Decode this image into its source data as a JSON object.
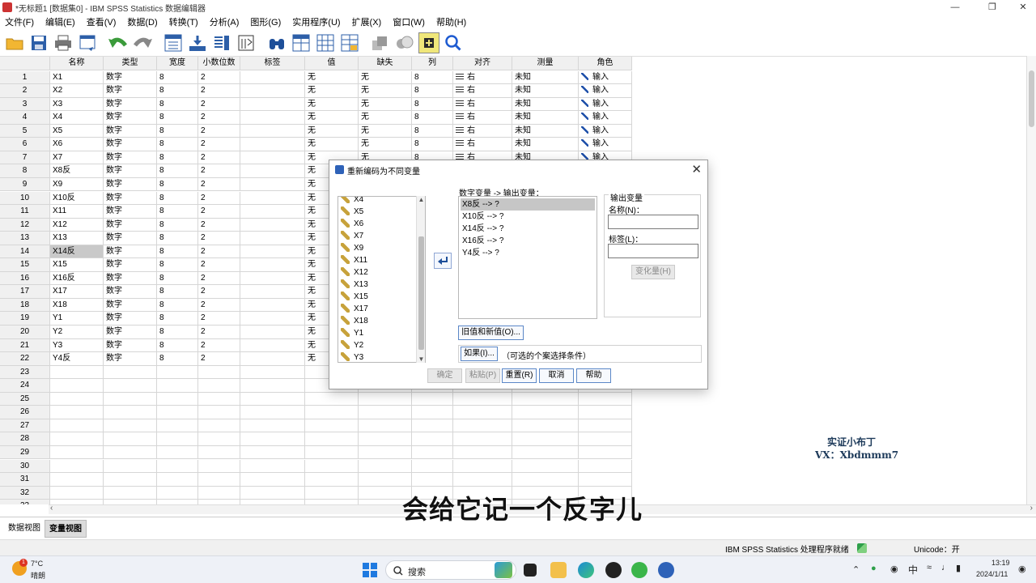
{
  "window": {
    "title": "*无标题1 [数据集0] - IBM SPSS Statistics 数据编辑器"
  },
  "menu": [
    "文件(F)",
    "编辑(E)",
    "查看(V)",
    "数据(D)",
    "转换(T)",
    "分析(A)",
    "图形(G)",
    "实用程序(U)",
    "扩展(X)",
    "窗口(W)",
    "帮助(H)"
  ],
  "toolbar_icons": [
    "open-folder-icon",
    "save-icon",
    "print-icon",
    "dialog-recall-icon",
    "undo-icon",
    "redo-icon",
    "goto-case-icon",
    "goto-variable-icon",
    "variables-icon",
    "find-icon",
    "insert-cases-icon",
    "insert-variable-icon",
    "split-file-icon",
    "weight-cases-icon",
    "select-cases-icon",
    "value-labels-icon",
    "use-sets-icon",
    "search-icon"
  ],
  "grid": {
    "columns": [
      "名称",
      "类型",
      "宽度",
      "小数位数",
      "标签",
      "值",
      "缺失",
      "列",
      "对齐",
      "测量",
      "角色"
    ],
    "rows": [
      [
        "X1",
        "数字",
        "8",
        "2",
        "",
        "无",
        "无",
        "8",
        "右",
        "未知",
        "输入"
      ],
      [
        "X2",
        "数字",
        "8",
        "2",
        "",
        "无",
        "无",
        "8",
        "右",
        "未知",
        "输入"
      ],
      [
        "X3",
        "数字",
        "8",
        "2",
        "",
        "无",
        "无",
        "8",
        "右",
        "未知",
        "输入"
      ],
      [
        "X4",
        "数字",
        "8",
        "2",
        "",
        "无",
        "无",
        "8",
        "右",
        "未知",
        "输入"
      ],
      [
        "X5",
        "数字",
        "8",
        "2",
        "",
        "无",
        "无",
        "8",
        "右",
        "未知",
        "输入"
      ],
      [
        "X6",
        "数字",
        "8",
        "2",
        "",
        "无",
        "无",
        "8",
        "右",
        "未知",
        "输入"
      ],
      [
        "X7",
        "数字",
        "8",
        "2",
        "",
        "无",
        "无",
        "8",
        "右",
        "未知",
        "输入"
      ],
      [
        "X8反",
        "数字",
        "8",
        "2",
        "",
        "无",
        "",
        "",
        "",
        "",
        ""
      ],
      [
        "X9",
        "数字",
        "8",
        "2",
        "",
        "无",
        "",
        "",
        "",
        "",
        ""
      ],
      [
        "X10反",
        "数字",
        "8",
        "2",
        "",
        "无",
        "",
        "",
        "",
        "",
        ""
      ],
      [
        "X11",
        "数字",
        "8",
        "2",
        "",
        "无",
        "",
        "",
        "",
        "",
        ""
      ],
      [
        "X12",
        "数字",
        "8",
        "2",
        "",
        "无",
        "",
        "",
        "",
        "",
        ""
      ],
      [
        "X13",
        "数字",
        "8",
        "2",
        "",
        "无",
        "",
        "",
        "",
        "",
        ""
      ],
      [
        "X14反",
        "数字",
        "8",
        "2",
        "",
        "无",
        "",
        "",
        "",
        "",
        ""
      ],
      [
        "X15",
        "数字",
        "8",
        "2",
        "",
        "无",
        "",
        "",
        "",
        "",
        ""
      ],
      [
        "X16反",
        "数字",
        "8",
        "2",
        "",
        "无",
        "",
        "",
        "",
        "",
        ""
      ],
      [
        "X17",
        "数字",
        "8",
        "2",
        "",
        "无",
        "",
        "",
        "",
        "",
        ""
      ],
      [
        "X18",
        "数字",
        "8",
        "2",
        "",
        "无",
        "",
        "",
        "",
        "",
        ""
      ],
      [
        "Y1",
        "数字",
        "8",
        "2",
        "",
        "无",
        "",
        "",
        "",
        "",
        ""
      ],
      [
        "Y2",
        "数字",
        "8",
        "2",
        "",
        "无",
        "",
        "",
        "",
        "",
        ""
      ],
      [
        "Y3",
        "数字",
        "8",
        "2",
        "",
        "无",
        "",
        "",
        "",
        "",
        ""
      ],
      [
        "Y4反",
        "数字",
        "8",
        "2",
        "",
        "无",
        "",
        "",
        "",
        "",
        ""
      ]
    ],
    "total_rows": 33,
    "selected_row": 14
  },
  "tabs": [
    "数据视图",
    "变量视图"
  ],
  "status": {
    "processor": "IBM SPSS Statistics 处理程序就绪",
    "unicode": "Unicode：开"
  },
  "dialog": {
    "title": "重新编码为不同变量",
    "source_items": [
      "X4",
      "X5",
      "X6",
      "X7",
      "X9",
      "X11",
      "X12",
      "X13",
      "X15",
      "X17",
      "X18",
      "Y1",
      "Y2",
      "Y3"
    ],
    "output_header": "数字变量 -> 输出变量：",
    "output_items": [
      "X8反 --> ?",
      "X10反 --> ?",
      "X14反 --> ?",
      "X16反 --> ?",
      "Y4反 --> ?"
    ],
    "output_group": "输出变量",
    "name_label": "名称(N)：",
    "label_label": "标签(L)：",
    "change_button": "变化量(H)",
    "old_new_button": "旧值和新值(O)...",
    "if_button": "如果(I)...",
    "if_hint": "（可选的个案选择条件）",
    "buttons": [
      "确定",
      "粘贴(P)",
      "重置(R)",
      "取消",
      "帮助"
    ]
  },
  "taskbar": {
    "temp": "7°C",
    "weather": "晴朗",
    "weather_badge": "1",
    "search": "搜索",
    "ime": "中",
    "time": "13:19",
    "date": "2024/1/11"
  },
  "overlay": {
    "watermark_line1": "实证小布丁",
    "watermark_line2": "VX：Xbdmmm7",
    "subtitle": "会给它记一个反字儿"
  }
}
